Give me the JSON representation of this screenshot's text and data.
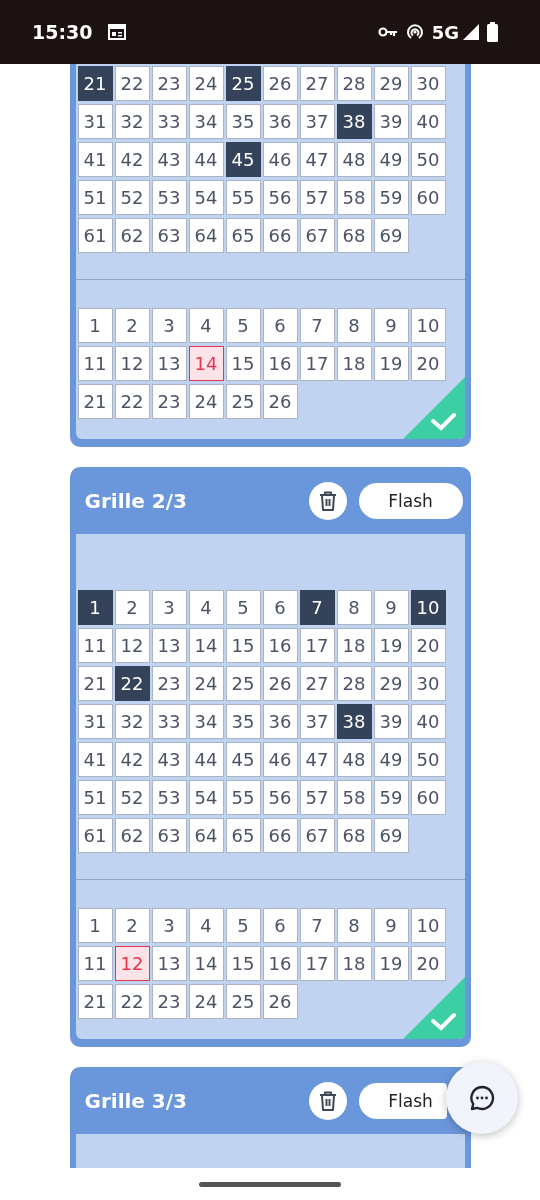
{
  "status_bar": {
    "time": "15:30",
    "network": "5G"
  },
  "cards": [
    {
      "main_numbers": [
        {
          "label": "21",
          "selected": true
        },
        {
          "label": "22",
          "selected": false
        },
        {
          "label": "23",
          "selected": false
        },
        {
          "label": "24",
          "selected": false
        },
        {
          "label": "25",
          "selected": true
        },
        {
          "label": "26",
          "selected": false
        },
        {
          "label": "27",
          "selected": false
        },
        {
          "label": "28",
          "selected": false
        },
        {
          "label": "29",
          "selected": false
        },
        {
          "label": "30",
          "selected": false
        },
        {
          "label": "31",
          "selected": false
        },
        {
          "label": "32",
          "selected": false
        },
        {
          "label": "33",
          "selected": false
        },
        {
          "label": "34",
          "selected": false
        },
        {
          "label": "35",
          "selected": false
        },
        {
          "label": "36",
          "selected": false
        },
        {
          "label": "37",
          "selected": false
        },
        {
          "label": "38",
          "selected": true
        },
        {
          "label": "39",
          "selected": false
        },
        {
          "label": "40",
          "selected": false
        },
        {
          "label": "41",
          "selected": false
        },
        {
          "label": "42",
          "selected": false
        },
        {
          "label": "43",
          "selected": false
        },
        {
          "label": "44",
          "selected": false
        },
        {
          "label": "45",
          "selected": true
        },
        {
          "label": "46",
          "selected": false
        },
        {
          "label": "47",
          "selected": false
        },
        {
          "label": "48",
          "selected": false
        },
        {
          "label": "49",
          "selected": false
        },
        {
          "label": "50",
          "selected": false
        },
        {
          "label": "51",
          "selected": false
        },
        {
          "label": "52",
          "selected": false
        },
        {
          "label": "53",
          "selected": false
        },
        {
          "label": "54",
          "selected": false
        },
        {
          "label": "55",
          "selected": false
        },
        {
          "label": "56",
          "selected": false
        },
        {
          "label": "57",
          "selected": false
        },
        {
          "label": "58",
          "selected": false
        },
        {
          "label": "59",
          "selected": false
        },
        {
          "label": "60",
          "selected": false
        },
        {
          "label": "61",
          "selected": false
        },
        {
          "label": "62",
          "selected": false
        },
        {
          "label": "63",
          "selected": false
        },
        {
          "label": "64",
          "selected": false
        },
        {
          "label": "65",
          "selected": false
        },
        {
          "label": "66",
          "selected": false
        },
        {
          "label": "67",
          "selected": false
        },
        {
          "label": "68",
          "selected": false
        },
        {
          "label": "69",
          "selected": false
        }
      ],
      "bonus_numbers": [
        {
          "label": "1",
          "selected": false
        },
        {
          "label": "2",
          "selected": false
        },
        {
          "label": "3",
          "selected": false
        },
        {
          "label": "4",
          "selected": false
        },
        {
          "label": "5",
          "selected": false
        },
        {
          "label": "6",
          "selected": false
        },
        {
          "label": "7",
          "selected": false
        },
        {
          "label": "8",
          "selected": false
        },
        {
          "label": "9",
          "selected": false
        },
        {
          "label": "10",
          "selected": false
        },
        {
          "label": "11",
          "selected": false
        },
        {
          "label": "12",
          "selected": false
        },
        {
          "label": "13",
          "selected": false
        },
        {
          "label": "14",
          "selected": true
        },
        {
          "label": "15",
          "selected": false
        },
        {
          "label": "16",
          "selected": false
        },
        {
          "label": "17",
          "selected": false
        },
        {
          "label": "18",
          "selected": false
        },
        {
          "label": "19",
          "selected": false
        },
        {
          "label": "20",
          "selected": false
        },
        {
          "label": "21",
          "selected": false
        },
        {
          "label": "22",
          "selected": false
        },
        {
          "label": "23",
          "selected": false
        },
        {
          "label": "24",
          "selected": false
        },
        {
          "label": "25",
          "selected": false
        },
        {
          "label": "26",
          "selected": false
        }
      ],
      "validated": true
    },
    {
      "title": "Grille 2/3",
      "flash_label": "Flash",
      "main_numbers": [
        {
          "label": "1",
          "selected": true
        },
        {
          "label": "2",
          "selected": false
        },
        {
          "label": "3",
          "selected": false
        },
        {
          "label": "4",
          "selected": false
        },
        {
          "label": "5",
          "selected": false
        },
        {
          "label": "6",
          "selected": false
        },
        {
          "label": "7",
          "selected": true
        },
        {
          "label": "8",
          "selected": false
        },
        {
          "label": "9",
          "selected": false
        },
        {
          "label": "10",
          "selected": true
        },
        {
          "label": "11",
          "selected": false
        },
        {
          "label": "12",
          "selected": false
        },
        {
          "label": "13",
          "selected": false
        },
        {
          "label": "14",
          "selected": false
        },
        {
          "label": "15",
          "selected": false
        },
        {
          "label": "16",
          "selected": false
        },
        {
          "label": "17",
          "selected": false
        },
        {
          "label": "18",
          "selected": false
        },
        {
          "label": "19",
          "selected": false
        },
        {
          "label": "20",
          "selected": false
        },
        {
          "label": "21",
          "selected": false
        },
        {
          "label": "22",
          "selected": true
        },
        {
          "label": "23",
          "selected": false
        },
        {
          "label": "24",
          "selected": false
        },
        {
          "label": "25",
          "selected": false
        },
        {
          "label": "26",
          "selected": false
        },
        {
          "label": "27",
          "selected": false
        },
        {
          "label": "28",
          "selected": false
        },
        {
          "label": "29",
          "selected": false
        },
        {
          "label": "30",
          "selected": false
        },
        {
          "label": "31",
          "selected": false
        },
        {
          "label": "32",
          "selected": false
        },
        {
          "label": "33",
          "selected": false
        },
        {
          "label": "34",
          "selected": false
        },
        {
          "label": "35",
          "selected": false
        },
        {
          "label": "36",
          "selected": false
        },
        {
          "label": "37",
          "selected": false
        },
        {
          "label": "38",
          "selected": true
        },
        {
          "label": "39",
          "selected": false
        },
        {
          "label": "40",
          "selected": false
        },
        {
          "label": "41",
          "selected": false
        },
        {
          "label": "42",
          "selected": false
        },
        {
          "label": "43",
          "selected": false
        },
        {
          "label": "44",
          "selected": false
        },
        {
          "label": "45",
          "selected": false
        },
        {
          "label": "46",
          "selected": false
        },
        {
          "label": "47",
          "selected": false
        },
        {
          "label": "48",
          "selected": false
        },
        {
          "label": "49",
          "selected": false
        },
        {
          "label": "50",
          "selected": false
        },
        {
          "label": "51",
          "selected": false
        },
        {
          "label": "52",
          "selected": false
        },
        {
          "label": "53",
          "selected": false
        },
        {
          "label": "54",
          "selected": false
        },
        {
          "label": "55",
          "selected": false
        },
        {
          "label": "56",
          "selected": false
        },
        {
          "label": "57",
          "selected": false
        },
        {
          "label": "58",
          "selected": false
        },
        {
          "label": "59",
          "selected": false
        },
        {
          "label": "60",
          "selected": false
        },
        {
          "label": "61",
          "selected": false
        },
        {
          "label": "62",
          "selected": false
        },
        {
          "label": "63",
          "selected": false
        },
        {
          "label": "64",
          "selected": false
        },
        {
          "label": "65",
          "selected": false
        },
        {
          "label": "66",
          "selected": false
        },
        {
          "label": "67",
          "selected": false
        },
        {
          "label": "68",
          "selected": false
        },
        {
          "label": "69",
          "selected": false
        }
      ],
      "bonus_numbers": [
        {
          "label": "1",
          "selected": false
        },
        {
          "label": "2",
          "selected": false
        },
        {
          "label": "3",
          "selected": false
        },
        {
          "label": "4",
          "selected": false
        },
        {
          "label": "5",
          "selected": false
        },
        {
          "label": "6",
          "selected": false
        },
        {
          "label": "7",
          "selected": false
        },
        {
          "label": "8",
          "selected": false
        },
        {
          "label": "9",
          "selected": false
        },
        {
          "label": "10",
          "selected": false
        },
        {
          "label": "11",
          "selected": false
        },
        {
          "label": "12",
          "selected": true
        },
        {
          "label": "13",
          "selected": false
        },
        {
          "label": "14",
          "selected": false
        },
        {
          "label": "15",
          "selected": false
        },
        {
          "label": "16",
          "selected": false
        },
        {
          "label": "17",
          "selected": false
        },
        {
          "label": "18",
          "selected": false
        },
        {
          "label": "19",
          "selected": false
        },
        {
          "label": "20",
          "selected": false
        },
        {
          "label": "21",
          "selected": false
        },
        {
          "label": "22",
          "selected": false
        },
        {
          "label": "23",
          "selected": false
        },
        {
          "label": "24",
          "selected": false
        },
        {
          "label": "25",
          "selected": false
        },
        {
          "label": "26",
          "selected": false
        }
      ],
      "validated": true
    },
    {
      "title": "Grille 3/3",
      "flash_label": "Flash"
    }
  ]
}
